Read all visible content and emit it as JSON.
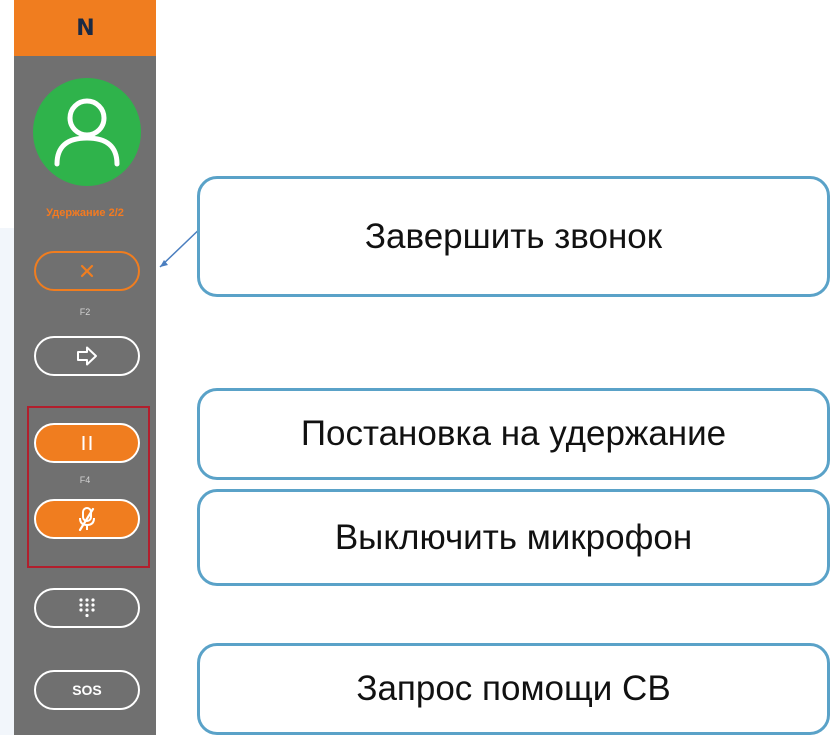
{
  "panel": {
    "logo_text": "N",
    "avatar_icon": "user-icon",
    "hold_status": "Удержание 2/2",
    "buttons": {
      "end_call": {
        "icon": "close-icon",
        "key": "F2"
      },
      "transfer": {
        "icon": "arrow-right-icon"
      },
      "hold": {
        "icon": "pause-icon",
        "key": "F4"
      },
      "mute": {
        "icon": "microphone-off-icon"
      },
      "dialpad": {
        "icon": "dialpad-icon"
      },
      "sos": {
        "label": "SOS"
      }
    }
  },
  "callouts": {
    "end_call": "Завершить звонок",
    "hold": "Постановка на удержание",
    "mute": "Выключить микрофон",
    "sos": "Запрос помощи СВ"
  },
  "colors": {
    "panel_bg": "#707070",
    "accent_orange": "#f07d1f",
    "avatar_green": "#2fb34b",
    "callout_border": "#5aa2c8",
    "highlight_red": "#b21f2d"
  }
}
